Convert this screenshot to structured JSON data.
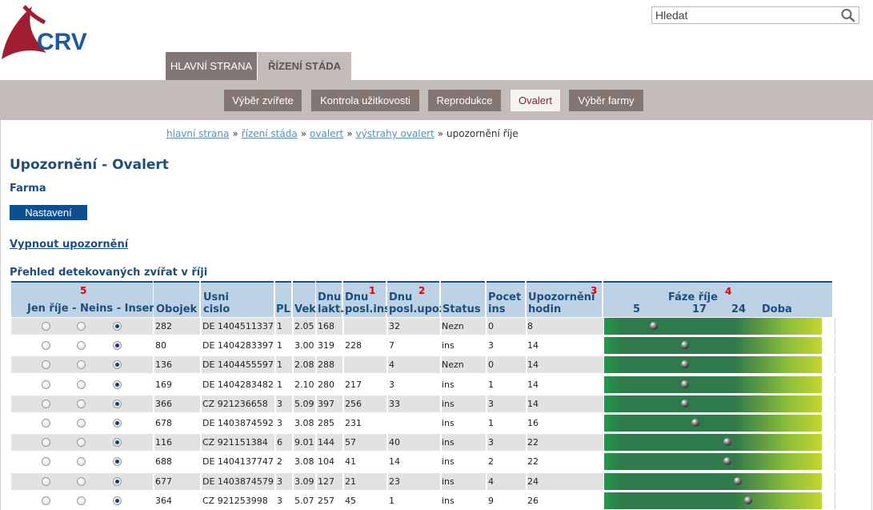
{
  "brand": {
    "logo_text": "CRV"
  },
  "search": {
    "placeholder": "Hledat"
  },
  "main_tabs": [
    {
      "label": "Hlavní strana",
      "active": false
    },
    {
      "label": "Řízení stáda",
      "active": true
    }
  ],
  "sub_nav": [
    {
      "label": "Výběr zvířete",
      "active": false
    },
    {
      "label": "Kontrola užitkovosti",
      "active": false
    },
    {
      "label": "Reprodukce",
      "active": false
    },
    {
      "label": "Ovalert",
      "active": true
    },
    {
      "label": "Výběr farmy",
      "active": false
    }
  ],
  "breadcrumb": {
    "links": [
      "hlavní strana",
      "řízení stáda",
      "ovalert",
      "výstrahy ovalert"
    ],
    "current": "upozornění říje",
    "separator": "»"
  },
  "page": {
    "title": "Upozornění - Ovalert",
    "farm_label": "Farma",
    "settings_button": "Nastavení",
    "disable_link": "Vypnout upozornění",
    "section_title": "Přehled detekovaných zvířat v říji"
  },
  "table": {
    "radio_header": "Jen říje - Neins - Insem",
    "radio_marker": "5",
    "headers": {
      "obojek": "Obojek",
      "usni_1": "Usni",
      "usni_2": "cislo",
      "pl": "PL",
      "vek": "Vek",
      "dnu_lakt_1": "Dnu",
      "dnu_lakt_2": "lakt.",
      "dnu_ins_1": "Dnu",
      "dnu_ins_2": "posl.ins",
      "dnu_ins_marker": "1",
      "dnu_upoz_1": "Dnu",
      "dnu_upoz_2": "posl.upoz",
      "dnu_upoz_marker": "2",
      "status": "Status",
      "pocet_1": "Pocet",
      "pocet_2": "ins",
      "upoz_1": "Upozornění",
      "upoz_2": "hodin",
      "upoz_marker": "3",
      "phase_title": "Fáze říje",
      "phase_marker": "4",
      "phase_labels": [
        "5",
        "17",
        "24",
        "Doba"
      ]
    },
    "rows": [
      {
        "radio": 2,
        "obojek": "282",
        "usni": "DE 1404511337",
        "pl": "1",
        "vek": "2.05",
        "dnu_lakt": "168",
        "dnu_posl_ins": "",
        "dnu_posl_upoz": "32",
        "status": "Nezn",
        "pocet_ins": "0",
        "upozorneni_hodin": "8",
        "phase_hours": 8
      },
      {
        "radio": 2,
        "obojek": "80",
        "usni": "DE 1404283397",
        "pl": "1",
        "vek": "3.00",
        "dnu_lakt": "319",
        "dnu_posl_ins": "228",
        "dnu_posl_upoz": "7",
        "status": "ins",
        "pocet_ins": "3",
        "upozorneni_hodin": "14",
        "phase_hours": 14
      },
      {
        "radio": 2,
        "obojek": "136",
        "usni": "DE 1404455597",
        "pl": "1",
        "vek": "2.08",
        "dnu_lakt": "288",
        "dnu_posl_ins": "",
        "dnu_posl_upoz": "4",
        "status": "Nezn",
        "pocet_ins": "0",
        "upozorneni_hodin": "14",
        "phase_hours": 14
      },
      {
        "radio": 2,
        "obojek": "169",
        "usni": "DE 1404283482",
        "pl": "1",
        "vek": "2.10",
        "dnu_lakt": "280",
        "dnu_posl_ins": "217",
        "dnu_posl_upoz": "3",
        "status": "ins",
        "pocet_ins": "1",
        "upozorneni_hodin": "14",
        "phase_hours": 14
      },
      {
        "radio": 2,
        "obojek": "366",
        "usni": "CZ 921236658",
        "pl": "3",
        "vek": "5.09",
        "dnu_lakt": "397",
        "dnu_posl_ins": "256",
        "dnu_posl_upoz": "33",
        "status": "ins",
        "pocet_ins": "3",
        "upozorneni_hodin": "14",
        "phase_hours": 14
      },
      {
        "radio": 2,
        "obojek": "678",
        "usni": "DE 1403874592",
        "pl": "3",
        "vek": "3.08",
        "dnu_lakt": "285",
        "dnu_posl_ins": "231",
        "dnu_posl_upoz": "",
        "status": "ins",
        "pocet_ins": "1",
        "upozorneni_hodin": "16",
        "phase_hours": 16
      },
      {
        "radio": 2,
        "obojek": "116",
        "usni": "CZ 921151384",
        "pl": "6",
        "vek": "9.01",
        "dnu_lakt": "144",
        "dnu_posl_ins": "57",
        "dnu_posl_upoz": "40",
        "status": "ins",
        "pocet_ins": "3",
        "upozorneni_hodin": "22",
        "phase_hours": 22
      },
      {
        "radio": 2,
        "obojek": "688",
        "usni": "DE 1404137747",
        "pl": "2",
        "vek": "3.08",
        "dnu_lakt": "104",
        "dnu_posl_ins": "41",
        "dnu_posl_upoz": "14",
        "status": "ins",
        "pocet_ins": "2",
        "upozorneni_hodin": "22",
        "phase_hours": 22
      },
      {
        "radio": 2,
        "obojek": "677",
        "usni": "DE 1403874579",
        "pl": "3",
        "vek": "3.09",
        "dnu_lakt": "127",
        "dnu_posl_ins": "21",
        "dnu_posl_upoz": "23",
        "status": "ins",
        "pocet_ins": "4",
        "upozorneni_hodin": "24",
        "phase_hours": 24
      },
      {
        "radio": 2,
        "obojek": "364",
        "usni": "CZ 921253998",
        "pl": "3",
        "vek": "5.07",
        "dnu_lakt": "257",
        "dnu_posl_ins": "45",
        "dnu_posl_upoz": "1",
        "status": "ins",
        "pocet_ins": "9",
        "upozorneni_hodin": "26",
        "phase_hours": 26
      }
    ]
  },
  "colors": {
    "brand_red": "#a01d32",
    "brand_blue": "#1c5aa0",
    "heading_blue": "#1c4e7f",
    "tab_active_bg": "#c3bcb8",
    "tab_bg": "#847773",
    "header_bg": "#bdd2e4",
    "marker_red": "#e0000b"
  }
}
